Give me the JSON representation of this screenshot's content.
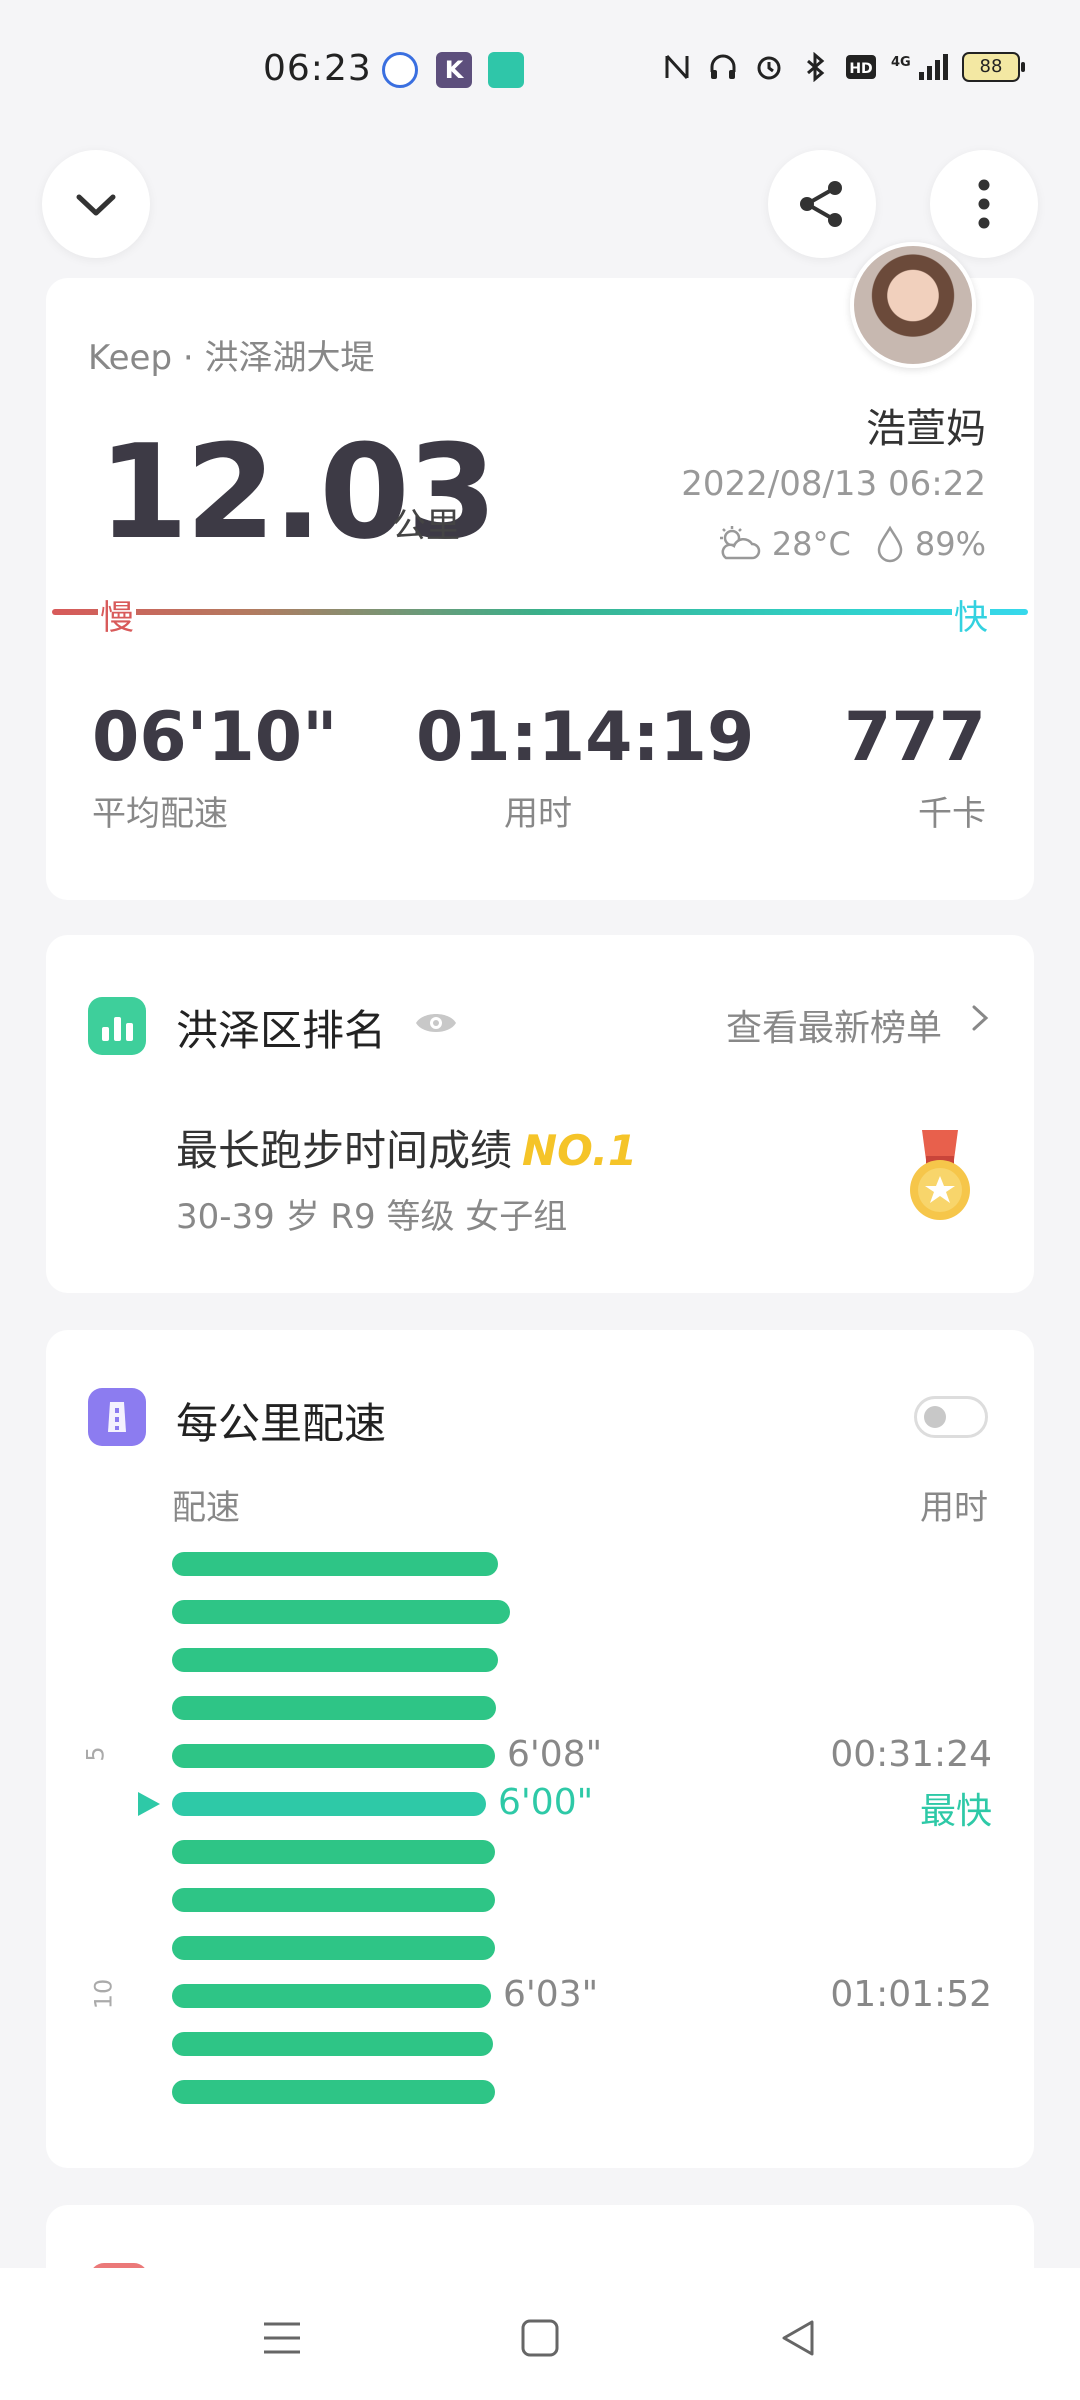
{
  "status_bar": {
    "time": "06:23",
    "apps": [
      "baidu-maps-icon",
      "k-app-icon",
      "green-app-icon"
    ],
    "network": "4G",
    "battery": "88"
  },
  "main_card": {
    "location": "Keep · 洪泽湖大堤",
    "distance": "12.03",
    "distance_unit": "公里",
    "username": "浩萱妈",
    "datetime": "2022/08/13 06:22",
    "temperature": "28°C",
    "humidity": "89%",
    "speed_slow_label": "慢",
    "speed_fast_label": "快",
    "stats": [
      {
        "value": "06'10\"",
        "label": "平均配速"
      },
      {
        "value": "01:14:19",
        "label": "用时"
      },
      {
        "value": "777",
        "label": "千卡"
      }
    ]
  },
  "rank_card": {
    "title": "洪泽区排名",
    "link": "查看最新榜单",
    "achievement": "最长跑步时间成绩",
    "rank_no": "NO.1",
    "subtitle": "30-39 岁 R9 等级 女子组"
  },
  "pace_card": {
    "title": "每公里配速",
    "col_pace": "配速",
    "col_time": "用时",
    "km_markers": [
      "5",
      "10"
    ],
    "splits": [
      {
        "pace": "",
        "time": ""
      },
      {
        "pace": "",
        "time": ""
      },
      {
        "pace": "",
        "time": ""
      },
      {
        "pace": "",
        "time": ""
      },
      {
        "pace": "6'08\"",
        "time": "00:31:24"
      },
      {
        "pace": "6'00\"",
        "time": "最快",
        "fastest": true
      },
      {
        "pace": "",
        "time": ""
      },
      {
        "pace": "",
        "time": ""
      },
      {
        "pace": "",
        "time": ""
      },
      {
        "pace": "6'03\"",
        "time": "01:01:52"
      },
      {
        "pace": "",
        "time": ""
      },
      {
        "pace": "",
        "time": ""
      }
    ],
    "bar_fraction": [
      0.965,
      1.0,
      0.965,
      0.96,
      0.955,
      0.93,
      0.955,
      0.955,
      0.955,
      0.945,
      0.95,
      0.955
    ]
  },
  "colors": {
    "accent_green": "#2ec586",
    "fastest_teal": "#2ec9a7",
    "gold": "#f5c428",
    "slow_red": "#d85a5a",
    "fast_cyan": "#37d8ec"
  }
}
